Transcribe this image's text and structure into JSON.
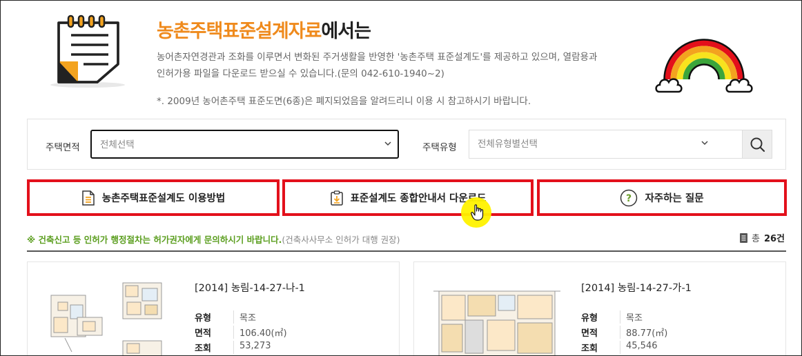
{
  "header": {
    "title_highlight": "농촌주택표준설계자료",
    "title_rest": "에서는",
    "desc_line1": "농어촌자연경관과 조화를 이루면서 변화된 주거생활을 반영한 '농촌주택 표준설계도'를 제공하고 있으며, 열람용과",
    "desc_line2": "인허가용 파일을 다운로드 받으실 수 있습니다.(문의 042-610-1940~2)",
    "notice": "*. 2009년 농어촌주택 표준도면(6종)은 폐지되었음을 알려드리니 이용 시 참고하시기 바랍니다."
  },
  "search": {
    "area_label": "주택면적",
    "area_value": "전체선택",
    "type_label": "주택유형",
    "type_value": "전체유형별선택"
  },
  "buttons": {
    "howto": "농촌주택표준설계도 이용방법",
    "download": "표준설계도 종합안내서 다운로드",
    "faq": "자주하는 질문"
  },
  "info": {
    "green_text": "※ 건축신고 등 인허가 행정절차는 허가권자에게 문의하시기 바랍니다.",
    "gray_text": "(건축사사무소 인허가 대행 권장)",
    "total_prefix": "총",
    "total_count": "26건"
  },
  "cards": [
    {
      "title": "[2014] 농림-14-27-나-1",
      "type_label": "유형",
      "type_value": "목조",
      "area_label": "면적",
      "area_value": "106.40(㎡)",
      "views_label": "조회",
      "views_value": "53,273"
    },
    {
      "title": "[2014] 농림-14-27-가-1",
      "type_label": "유형",
      "type_value": "목조",
      "area_label": "면적",
      "area_value": "88.77(㎡)",
      "views_label": "조회",
      "views_value": "45,546"
    }
  ],
  "colors": {
    "accent_orange": "#ef8a1c",
    "highlight_red": "#e3101b",
    "notice_green": "#5b9e1f"
  },
  "icons": {
    "header": "notepad-icon",
    "decoration": "rainbow-icon",
    "search": "search-icon",
    "howto": "document-icon",
    "download": "clipboard-download-icon",
    "faq": "question-icon",
    "total": "list-icon"
  }
}
